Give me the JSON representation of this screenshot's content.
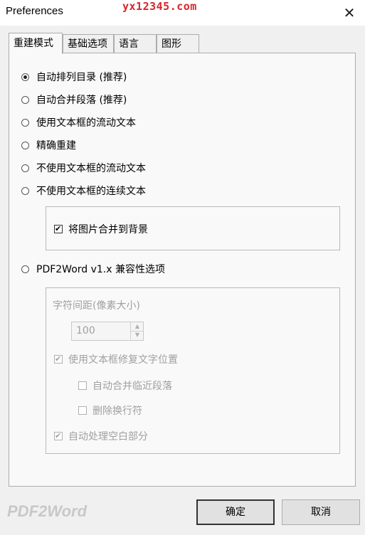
{
  "window": {
    "title": "Preferences",
    "watermark": "yx12345.com",
    "close_label": "✕"
  },
  "tabs": [
    {
      "label": "重建模式",
      "active": true
    },
    {
      "label": "基础选项",
      "active": false
    },
    {
      "label": "语言",
      "active": false
    },
    {
      "label": "图形",
      "active": false
    }
  ],
  "mode_options": [
    {
      "label": "自动排列目录 (推荐)",
      "selected": true
    },
    {
      "label": "自动合并段落 (推荐)",
      "selected": false
    },
    {
      "label": "使用文本框的流动文本",
      "selected": false
    },
    {
      "label": "精确重建",
      "selected": false
    },
    {
      "label": "不使用文本框的流动文本",
      "selected": false
    },
    {
      "label": "不使用文本框的连续文本",
      "selected": false
    }
  ],
  "merge_images_checkbox": {
    "label": "将图片合并到背景",
    "checked": true
  },
  "legacy_option": {
    "label": "PDF2Word v1.x 兼容性选项",
    "selected": false
  },
  "legacy_group": {
    "char_spacing_label": "字符间距(像素大小)",
    "char_spacing_value": "100",
    "use_textbox_fix": {
      "label": "使用文本框修复文字位置",
      "checked": true
    },
    "auto_merge_adjacent": {
      "label": "自动合并临近段落",
      "checked": false
    },
    "remove_line_breaks": {
      "label": "删除换行符",
      "checked": false
    },
    "auto_whitespace": {
      "label": "自动处理空白部分",
      "checked": true
    }
  },
  "footer": {
    "brand": "PDF2Word",
    "ok_label": "确定",
    "cancel_label": "取消"
  }
}
